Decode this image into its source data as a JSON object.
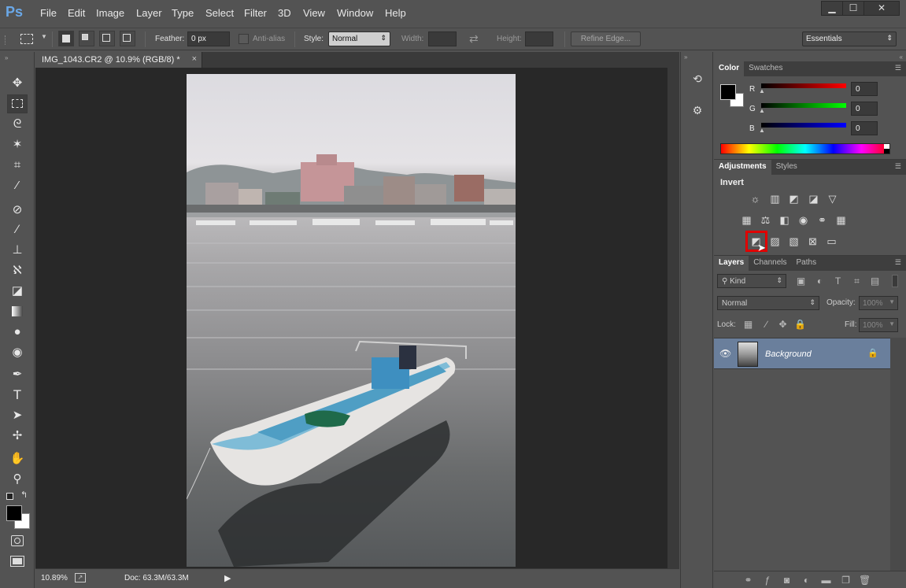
{
  "app": {
    "logo": "Ps"
  },
  "menu": [
    "File",
    "Edit",
    "Image",
    "Layer",
    "Type",
    "Select",
    "Filter",
    "3D",
    "View",
    "Window",
    "Help"
  ],
  "window": {
    "minimize": "▁",
    "maximize": "☐",
    "close": "✕"
  },
  "options": {
    "feather_label": "Feather:",
    "feather_value": "0 px",
    "antialias_label": "Anti-alias",
    "style_label": "Style:",
    "style_value": "Normal",
    "width_label": "Width:",
    "height_label": "Height:",
    "refine_edge": "Refine Edge...",
    "workspace": "Essentials"
  },
  "document": {
    "tab_title": "IMG_1043.CR2 @ 10.9% (RGB/8) *",
    "close": "×"
  },
  "status": {
    "zoom": "10.89%",
    "doc": "Doc: 63.3M/63.3M"
  },
  "tools": [
    "move-tool-icon",
    "marquee-tool-icon",
    "lasso-tool-icon",
    "magic-wand-icon",
    "crop-tool-icon",
    "eyedropper-icon",
    "healing-brush-icon",
    "brush-tool-icon",
    "clone-stamp-icon",
    "history-brush-icon",
    "eraser-icon",
    "gradient-icon",
    "blur-tool-icon",
    "dodge-tool-icon",
    "pen-tool-icon",
    "type-tool-icon",
    "path-selection-icon",
    "shape-tool-icon",
    "hand-tool-icon",
    "zoom-tool-icon"
  ],
  "color_panel": {
    "tabs": [
      "Color",
      "Swatches"
    ],
    "channels": [
      {
        "label": "R",
        "value": "0",
        "color": "#d02020"
      },
      {
        "label": "G",
        "value": "0",
        "color": "#20b020"
      },
      {
        "label": "B",
        "value": "0",
        "color": "#2040d0"
      }
    ]
  },
  "adjustments_panel": {
    "tabs": [
      "Adjustments",
      "Styles"
    ],
    "heading": "Invert",
    "selected": "invert-icon"
  },
  "layers_panel": {
    "tabs": [
      "Layers",
      "Channels",
      "Paths"
    ],
    "filter": "Kind",
    "blend_mode": "Normal",
    "opacity_label": "Opacity:",
    "opacity_value": "100%",
    "lock_label": "Lock:",
    "fill_label": "Fill:",
    "fill_value": "100%",
    "layers": [
      {
        "name": "Background"
      }
    ]
  },
  "colors": {
    "accent_highlight": "#e00000",
    "layer_selected": "#6a7f9c"
  }
}
